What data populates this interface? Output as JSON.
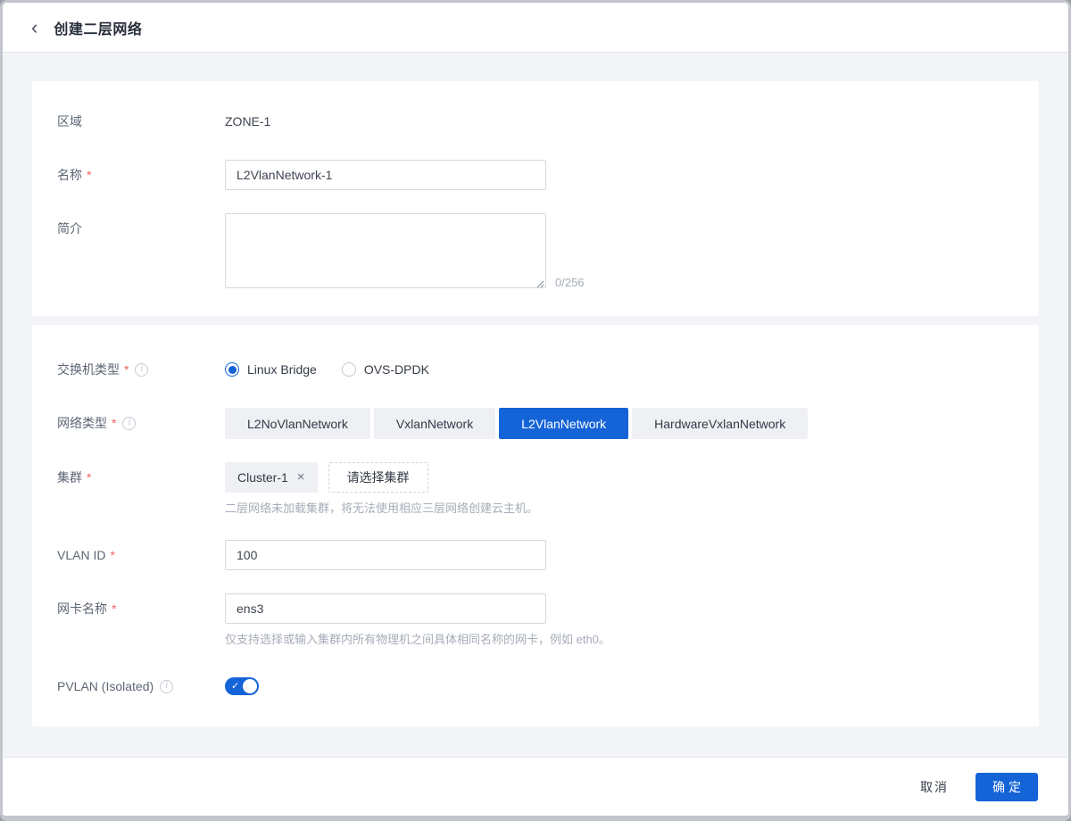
{
  "header": {
    "title": "创建二层网络"
  },
  "icons": {
    "back": "‹",
    "info": "i",
    "close": "×",
    "check": "✓"
  },
  "form": {
    "zone": {
      "label": "区域",
      "value": "ZONE-1"
    },
    "name": {
      "label": "名称",
      "required": "*",
      "value": "L2VlanNetwork-1"
    },
    "description": {
      "label": "简介",
      "value": "",
      "counter": "0/256"
    },
    "switch_type": {
      "label": "交换机类型",
      "required": "*",
      "options": [
        {
          "label": "Linux Bridge",
          "selected": true
        },
        {
          "label": "OVS-DPDK",
          "selected": false
        }
      ]
    },
    "network_type": {
      "label": "网络类型",
      "required": "*",
      "options": [
        {
          "label": "L2NoVlanNetwork",
          "selected": false
        },
        {
          "label": "VxlanNetwork",
          "selected": false
        },
        {
          "label": "L2VlanNetwork",
          "selected": true
        },
        {
          "label": "HardwareVxlanNetwork",
          "selected": false
        }
      ]
    },
    "cluster": {
      "label": "集群",
      "required": "*",
      "tag": "Cluster-1",
      "select_button": "请选择集群",
      "help": "二层网络未加载集群，将无法使用相应三层网络创建云主机。"
    },
    "vlan_id": {
      "label": "VLAN ID",
      "required": "*",
      "value": "100"
    },
    "nic_name": {
      "label": "网卡名称",
      "required": "*",
      "value": "ens3",
      "help": "仅支持选择或输入集群内所有物理机之间具体相同名称的网卡，例如 eth0。"
    },
    "pvlan": {
      "label": "PVLAN (Isolated)",
      "enabled": true
    }
  },
  "footer": {
    "cancel": "取消",
    "confirm": "确定"
  },
  "colors": {
    "accent": "#1464d8",
    "page_bg": "#f3f4f8",
    "card_bg": "#ffffff",
    "required_red": "#f06464",
    "helper_gray": "#a6acb8"
  }
}
